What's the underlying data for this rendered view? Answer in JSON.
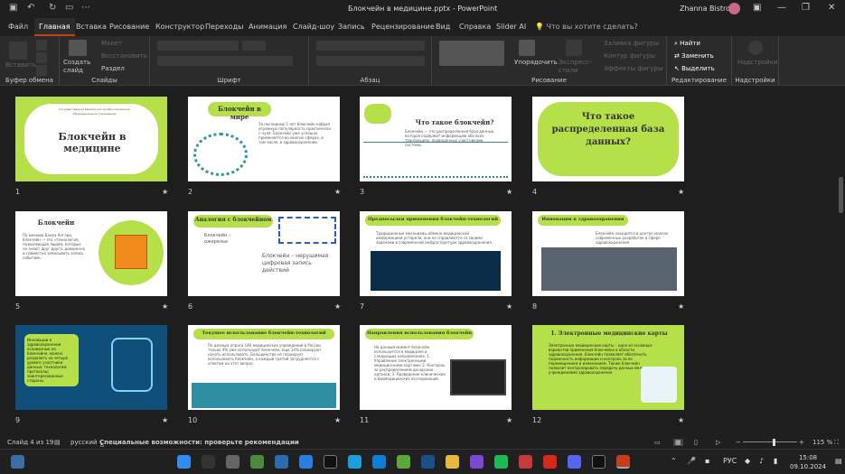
{
  "window": {
    "title": "Блокчейн в медицине.pptx - PowerPoint",
    "user": "Zhanna Bistrova"
  },
  "tabs": [
    "Файл",
    "Главная",
    "Вставка",
    "Рисование",
    "Конструктор",
    "Переходы",
    "Анимация",
    "Слайд-шоу",
    "Запись",
    "Рецензирование",
    "Вид",
    "Справка",
    "Slider AI"
  ],
  "search": "Что вы хотите сделать?",
  "ribbon": {
    "clipboard": {
      "paste": "Вставить",
      "label": "Буфер обмена"
    },
    "slides": {
      "new": "Создать слайд",
      "layout": "Макет",
      "reset": "Восстановить",
      "section": "Раздел",
      "label": "Слайды"
    },
    "font": {
      "label": "Шрифт"
    },
    "paragraph": {
      "label": "Абзац"
    },
    "drawing": {
      "arrange": "Упорядочить",
      "styles": "Экспресс-стили",
      "fill": "Заливка фигуры",
      "outline": "Контур фигуры",
      "effects": "Эффекты фигуры",
      "label": "Рисование"
    },
    "editing": {
      "find": "Найти",
      "replace": "Заменить",
      "select": "Выделить",
      "label": "Редактирование"
    },
    "addins": {
      "btn": "Надстройки",
      "label": "Надстройки"
    }
  },
  "slides": [
    {
      "n": "1",
      "title": "Блокчейн в медицине",
      "header": "Государственное бюджетное профессиональное образовательное учреждение"
    },
    {
      "n": "2",
      "title": "Блокчейн в мире",
      "text": "За последние 5 лет блокчейн набрал огромную популярность практически с нуля. Блокчейн уже успешно применяется во многих сферах, в том числе, в здравоохранении."
    },
    {
      "n": "3",
      "title": "Что такое блокчейн?",
      "text": "Блокчейн — это распределенная база данных, которая содержит информацию обо всех транзакциях, проведенных участниками системы."
    },
    {
      "n": "4",
      "title": "Что такое распределенная база данных?"
    },
    {
      "n": "5",
      "title": "Блокчейн",
      "text": "По мнению Банка Англии, блокчейн — это «технология, позволяющая людям, которые не знают друг друга, доверенно и совместно записывать запись событий»."
    },
    {
      "n": "6",
      "title": "Аналогия с блокчейном",
      "text": "Блокчейн – ожерелье",
      "text2": "Блокчейн – нерушимая цифровая запись действий"
    },
    {
      "n": "7",
      "title": "Предпосылки применения блокчейн-технологий",
      "text": "Традиционные механизмы обмена медицинской информацией устарели, они не справляются со своими задачами в современной инфраструктуре здравоохранения."
    },
    {
      "n": "8",
      "title": "Инновации в здравоохранении",
      "text": "Блокчейн находится в центре многих современных разработок в сфере здравоохранения."
    },
    {
      "n": "9",
      "text": "Инновации в здравоохранении основанные на блокчейне, можно разделить на четыре уровня: участники данных; технологии; протоколы; заинтересованные стороны."
    },
    {
      "n": "10",
      "title": "Текущее использование блокчейн-технологий",
      "text": "По данным опроса 146 медицинских учреждений в России, только 4% уже используют блокчейн, еще 14% планируют начать использовать. Большинство не планирует использовать блокчейн, а каждый третий затрудняется с ответом на этот вопрос."
    },
    {
      "n": "11",
      "title": "Направления использования блокчейн",
      "text": "На данный момент блокчейн используется в медицине в следующих направлениях: 1. Управление электронными медицинскими картами; 2. Контроль за распределением донорских органов; 3. Проведение клинических и биомедицинских исследований."
    },
    {
      "n": "12",
      "title": "1. Электронные медицинские карты",
      "text": "Электронные медицинские карты – одно из основных вариантов применения блокчейна в области здравоохранения. Блокчейн позволяет обеспечить подлинность информации и контроль за ее перемещением и изменением. Также блокчейн позволит контролировать передачу данных между учреждениями здравоохранения."
    }
  ],
  "status": {
    "slide": "Слайд 4 из 19",
    "lang": "русский",
    "access": "Специальные возможности: проверьте рекомендации",
    "zoom": "115 %"
  },
  "taskbar": {
    "lang": "РУС",
    "time": "15:08",
    "date": "09.10.2024"
  }
}
